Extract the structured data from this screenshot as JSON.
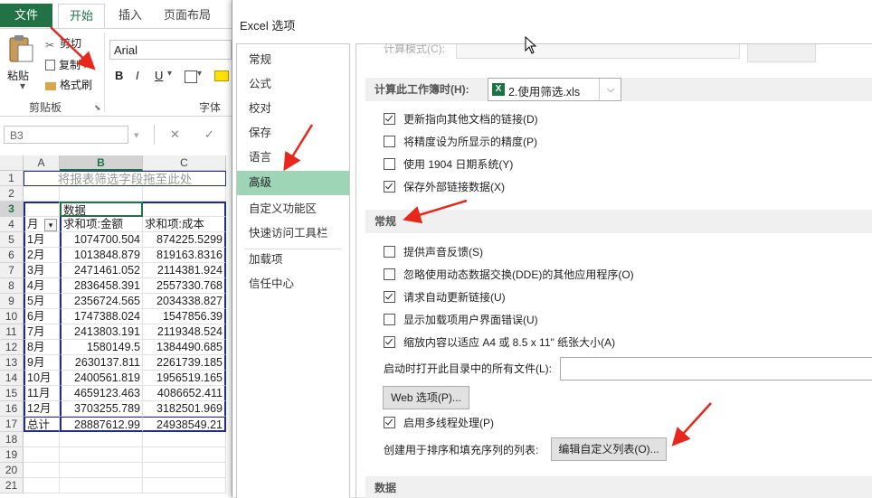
{
  "ribbon": {
    "tabs": {
      "file": "文件",
      "home": "开始",
      "insert": "插入",
      "page_layout": "页面布局"
    },
    "clipboard": {
      "paste": "粘贴",
      "cut": "剪切",
      "copy": "复制",
      "copy_dropdown": "▾",
      "format_painter": "格式刷",
      "group_label": "剪贴板"
    },
    "font": {
      "name": "Arial",
      "bold": "B",
      "italic": "I",
      "underline": "U",
      "group_label": "字体"
    }
  },
  "formula_bar": {
    "name_box": "B3",
    "cancel": "✕",
    "enter": "✓"
  },
  "sheet": {
    "columns": [
      "A",
      "B",
      "C"
    ],
    "row_numbers": [
      "1",
      "2",
      "3",
      "4",
      "5",
      "6",
      "7",
      "8",
      "9",
      "10",
      "11",
      "12",
      "13",
      "14",
      "15",
      "16",
      "17",
      "18",
      "19",
      "20",
      "21"
    ],
    "filter_area_hint": "将报表筛选字段拖至此处",
    "data_label": "数据",
    "header": {
      "month": "月",
      "sum_amount": "求和项:金额",
      "sum_cost": "求和项:成本"
    },
    "rows": [
      {
        "month": "1月",
        "amount": "1074700.504",
        "cost": "874225.5299"
      },
      {
        "month": "2月",
        "amount": "1013848.879",
        "cost": "819163.8316"
      },
      {
        "month": "3月",
        "amount": "2471461.052",
        "cost": "2114381.924"
      },
      {
        "month": "4月",
        "amount": "2836458.391",
        "cost": "2557330.768"
      },
      {
        "month": "5月",
        "amount": "2356724.565",
        "cost": "2034338.827"
      },
      {
        "month": "6月",
        "amount": "1747388.024",
        "cost": "1547856.39"
      },
      {
        "month": "7月",
        "amount": "2413803.191",
        "cost": "2119348.524"
      },
      {
        "month": "8月",
        "amount": "1580149.5",
        "cost": "1384490.685"
      },
      {
        "month": "9月",
        "amount": "2630137.811",
        "cost": "2261739.185"
      },
      {
        "month": "10月",
        "amount": "2400561.819",
        "cost": "1956519.165"
      },
      {
        "month": "11月",
        "amount": "4659123.463",
        "cost": "4086652.411"
      },
      {
        "month": "12月",
        "amount": "3703255.789",
        "cost": "3182501.969"
      },
      {
        "month": "总计",
        "amount": "28887612.99",
        "cost": "24938549.21"
      }
    ]
  },
  "dialog": {
    "title": "Excel 选项",
    "nav": [
      "常规",
      "公式",
      "校对",
      "保存",
      "语言",
      "高级",
      "自定义功能区",
      "快速访问工具栏",
      "加载项",
      "信任中心"
    ],
    "selected_nav": "高级",
    "partial_top_label": "计算模式(C):",
    "workbook_label": "计算此工作簿时(H):",
    "workbook_value": "2.使用筛选.xls",
    "calc_options": [
      {
        "label": "更新指向其他文档的链接(D)",
        "checked": true
      },
      {
        "label": "将精度设为所显示的精度(P)",
        "checked": false
      },
      {
        "label": "使用 1904 日期系统(Y)",
        "checked": false
      },
      {
        "label": "保存外部链接数据(X)",
        "checked": true
      }
    ],
    "general_header": "常规",
    "general_options": [
      {
        "label": "提供声音反馈(S)",
        "checked": false
      },
      {
        "label": "忽略使用动态数据交换(DDE)的其他应用程序(O)",
        "checked": false
      },
      {
        "label": "请求自动更新链接(U)",
        "checked": true
      },
      {
        "label": "显示加载项用户界面错误(U)",
        "checked": false
      },
      {
        "label": "缩放内容以适应 A4 或 8.5 x 11\" 纸张大小(A)",
        "checked": true
      }
    ],
    "startup_label": "启动时打开此目录中的所有文件(L):",
    "startup_value": "",
    "web_options_button": "Web 选项(P)...",
    "multithread_label": "启用多线程处理(P)",
    "multithread_checked": true,
    "custom_list_label": "创建用于排序和填充序列的列表:",
    "custom_list_button": "编辑自定义列表(O)...",
    "data_header": "数据"
  },
  "colors": {
    "excel_green": "#217346",
    "nav_selected": "#9fd5b7",
    "pivot_border": "#1f2d86",
    "annotation_red": "#e8261c"
  }
}
